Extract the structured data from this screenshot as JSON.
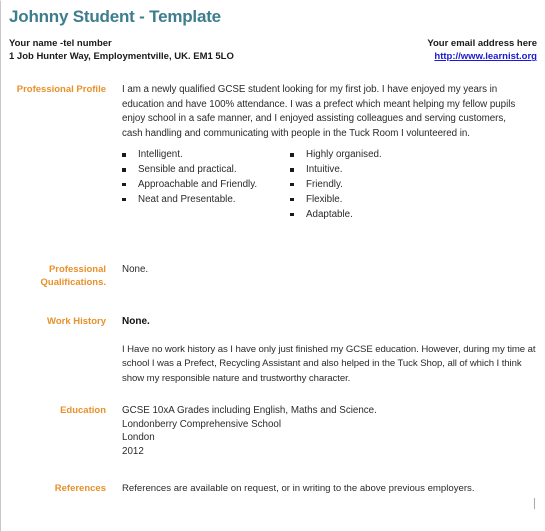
{
  "document": {
    "title": "Johnny Student - Template",
    "title_color": "#3d7d8e",
    "label_color": "#e8912a",
    "link_color": "#1a1ad0"
  },
  "contact": {
    "name_line": "Your name -tel number",
    "address_line": "1 Job Hunter Way, Employmentville, UK. EM1 5LO",
    "email_label": "Your email address here",
    "website": "http://www.learnist.org"
  },
  "sections": {
    "profile": {
      "label": "Professional Profile",
      "paragraph": "I am a newly qualified GCSE student looking for my first job. I have enjoyed my years in education and have 100% attendance. I was a prefect which meant helping my fellow pupils enjoy school in a safe manner, and I enjoyed assisting colleagues and serving customers, cash handling and communicating with people in the Tuck Room I volunteered in.",
      "bullets_left": [
        "Intelligent.",
        "Sensible and practical.",
        "Approachable and Friendly.",
        "Neat and Presentable."
      ],
      "bullets_right": [
        "Highly organised.",
        "Intuitive.",
        "Friendly.",
        "Flexible.",
        "Adaptable."
      ]
    },
    "qualifications": {
      "label": "Professional Qualifications.",
      "value": "None."
    },
    "work_history": {
      "label": "Work History",
      "value": "None.",
      "paragraph": "I Have no work history as I have only just finished my GCSE education. However, during my time at school I was a Prefect, Recycling Assistant and also helped in the Tuck Shop, all of which I think show my responsible nature and trustworthy character."
    },
    "education": {
      "label": "Education",
      "lines": [
        "GCSE 10xA Grades including English, Maths and Science.",
        "Londonberry Comprehensive School",
        "London",
        "2012"
      ]
    },
    "references": {
      "label": "References",
      "paragraph": "References are available on request, or in writing to the above previous employers."
    }
  }
}
